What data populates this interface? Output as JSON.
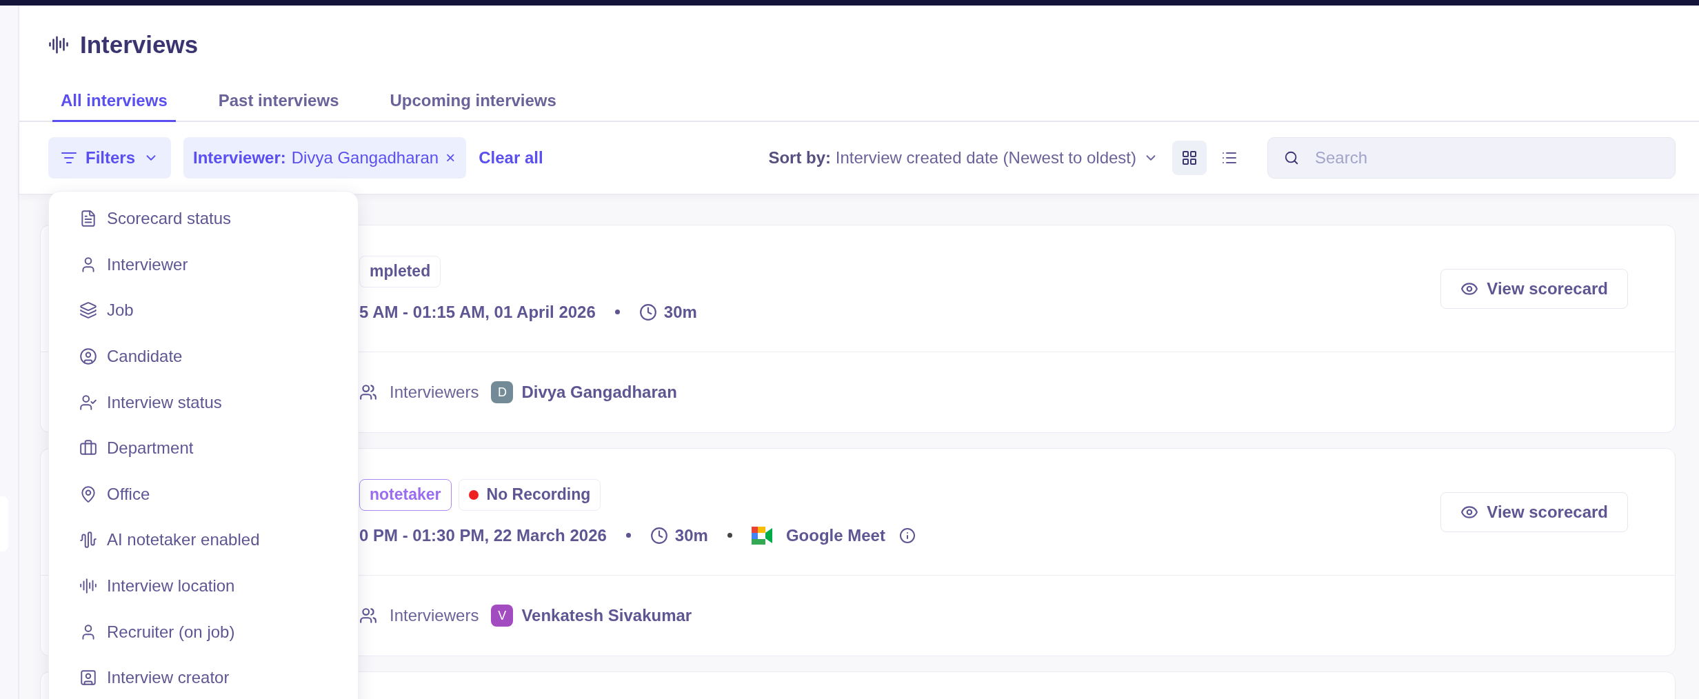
{
  "page": {
    "title": "Interviews"
  },
  "tabs": [
    {
      "label": "All interviews",
      "selected": true
    },
    {
      "label": "Past interviews",
      "selected": false
    },
    {
      "label": "Upcoming interviews",
      "selected": false
    }
  ],
  "filters": {
    "button": "Filters",
    "chips": [
      {
        "key": "Interviewer:",
        "value": "Divya Gangadharan",
        "remove": "×"
      }
    ],
    "clear": "Clear all"
  },
  "sort": {
    "label": "Sort by:",
    "value": "Interview created date (Newest to oldest)"
  },
  "views": [
    {
      "kind": "grid",
      "selected": true
    },
    {
      "kind": "list",
      "selected": false
    }
  ],
  "search": {
    "placeholder": "Search"
  },
  "filter_menu": [
    {
      "kind": "scorecard",
      "label": "Scorecard status"
    },
    {
      "kind": "person",
      "label": "Interviewer"
    },
    {
      "kind": "layers",
      "label": "Job"
    },
    {
      "kind": "circle-person",
      "label": "Candidate"
    },
    {
      "kind": "status",
      "label": "Interview status"
    },
    {
      "kind": "briefcase",
      "label": "Department"
    },
    {
      "kind": "pin",
      "label": "Office"
    },
    {
      "kind": "wave",
      "label": "AI notetaker enabled"
    },
    {
      "kind": "audio",
      "label": "Interview location"
    },
    {
      "kind": "person",
      "label": "Recruiter (on job)"
    },
    {
      "kind": "square-person",
      "label": "Interview creator"
    }
  ],
  "cards": [
    {
      "kind": "interview",
      "badges": [
        {
          "kind": "plain",
          "text": "mpleted"
        }
      ],
      "time": "5 AM - 01:15 AM, 01 April 2026",
      "duration": "30m",
      "interviewers_label": "Interviewers",
      "interviewers": [
        {
          "initial": "D",
          "name": "Divya Gangadharan",
          "color": "#728b96"
        }
      ],
      "action": "View scorecard"
    },
    {
      "kind": "interview",
      "badges": [
        {
          "kind": "ai",
          "text": "notetaker"
        },
        {
          "kind": "recording",
          "text": "No Recording"
        }
      ],
      "time": "0 PM - 01:30 PM, 22 March 2026",
      "duration": "30m",
      "location": "Google Meet",
      "interviewers_label": "Interviewers",
      "interviewers": [
        {
          "initial": "V",
          "name": "Venkatesh Sivakumar",
          "color": "#a34bc0"
        }
      ],
      "action": "View scorecard"
    },
    {
      "kind": "partial"
    }
  ]
}
